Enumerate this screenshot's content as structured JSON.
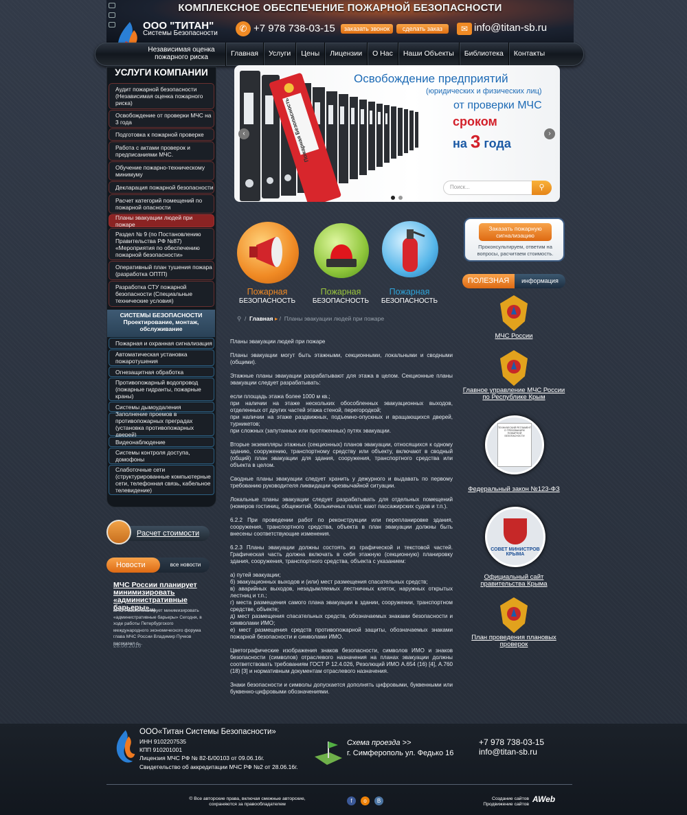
{
  "header": {
    "title": "КОМПЛЕКСНОЕ ОБЕСПЕЧЕНИЕ ПОЖАРНОЙ БЕЗОПАСНОСТИ",
    "brand": "ООО \"ТИТАН\"",
    "brand_sub": "Системы Безопасности",
    "phone": "+7 978 738-03-15",
    "callback_btn": "заказать звонок",
    "order_btn": "сделать заказ",
    "email": "info@titan-sb.ru"
  },
  "nav": {
    "tagline": "Независимая оценка пожарного риска",
    "items": [
      "Главная",
      "Услуги",
      "Цены",
      "Лицензии",
      "О Нас",
      "Наши Объекты",
      "Библиотека",
      "Контакты"
    ]
  },
  "sidebar": {
    "heading": "УСЛУГИ КОМПАНИИ",
    "services": [
      "Аудит пожарной безопасности (Независимая оценка пожарного риска)",
      "Освобождение от проверки МЧС на 3 года",
      "Подготовка к пожарной проверке",
      "Работа с актами проверок и предписаниями МЧС.",
      "Обучение пожарно-техническому минимуму",
      "Декларация пожарной безопасности",
      "Расчет категорий помещений по пожарной опасности",
      "Планы эвакуации людей при пожаре",
      "Раздел № 9 (по Постановлению Правительства РФ №87) «Мероприятия по обеспечению пожарной безопасности»",
      "Оперативный план тушения пожара (разработка ОПТП)",
      "Разработка СТУ пожарной безопасности (Специальные технические условия)"
    ],
    "systems_heading_1": "СИСТЕМЫ БЕЗОПАСНОСТИ",
    "systems_heading_2": "Проектирование, монтаж, обслуживание",
    "systems": [
      "Пожарная и охранная сигнализация",
      "Автоматическая установка пожаротушения",
      "Огнезащитная обработка",
      "Противопожарный водопровод (пожарные гидранты, пожарные краны)",
      "Системы дымоудаления",
      "Заполнение проемов в противопожарных преградах (установка противопожарных дверей)",
      "Видеонаблюдение",
      "Системы контроля доступа, домофоны",
      "Слаботочные сети (структурированные компьютерные сети, телефонная связь, кабельное телевидение)"
    ],
    "calc_label": "Расчет стоимости",
    "news_label": "Новости",
    "all_news": "все новости",
    "news_title": "МЧС России планирует минимизировать «административные барьеры»...",
    "news_text": "МЧС России планирует минимизировать «административные барьеры» Сегодня, в ходе работы Петербургского международного экономического форума глава МЧС России Владимир Пучков рассказал о...",
    "news_date": "28.06.2016"
  },
  "slider": {
    "line1": "Освобождение предприятий",
    "line2": "(юридических и физических лиц)",
    "line3": "от проверки МЧС",
    "line4": "сроком",
    "line5a": "на",
    "line5b": "3",
    "line5c": "года",
    "binder_text": "Пожарная Безопасность",
    "search_placeholder": "Поиск..."
  },
  "features": [
    {
      "t1": "Пожарная",
      "t2": "БЕЗОПАСНОСТЬ",
      "color": "#f08a24"
    },
    {
      "t1": "Пожарная",
      "t2": "БЕЗОПАСНОСТЬ",
      "color": "#9bc53d"
    },
    {
      "t1": "Пожарная",
      "t2": "БЕЗОПАСНОСТЬ",
      "color": "#2fa4d9"
    }
  ],
  "breadcrumb": {
    "home": "Главная",
    "current": "Планы эвакуации людей при пожаре"
  },
  "content": {
    "paragraphs": [
      "Планы эвакуации людей при пожаре",
      "Планы эвакуации могут быть этажными, секционными, локальными и сводными (общими).",
      "Этажные планы эвакуации разрабатывают для этажа в целом. Секционные планы эвакуации следует разрабатывать:",
      "если площадь этажа более 1000 м кв.;\nпри наличии на этаже нескольких обособленных эвакуационных выходов, отделенных от других частей этажа стеной, перегородкой;\nпри наличии на этаже раздвижных, подъемно-опускных и вращающихся дверей, турникетов;\nпри сложных (запутанных или протяженных) путях эвакуации.",
      "",
      "Вторые экземпляры этажных (секционных) планов эвакуации, относящихся к одному зданию, сооружению, транспортному средству или объекту, включают в сводный (общий) план эвакуации для здания, сооружения, транспортного средства или объекта в целом.",
      "Сводные планы эвакуации следует хранить у дежурного и выдавать по первому требованию руководителя ликвидации чрезвычайной ситуации.",
      "Локальные планы эвакуации следует разрабатывать для отдельных помещений (номеров гостиниц, общежитий, больничных палат, кают пассажирских судов и т.п.).",
      "6.2.2 При проведении работ по реконструкции или перепланировке здания, сооружения, транспортного средства, объекта в план эвакуации должны быть внесены соответствующие изменения.",
      "6.2.3 Планы эвакуации должны состоять из графической и текстовой частей. Графическая часть должна включать в себя этажную (секционную) планировку здания, сооружения, транспортного средства, объекта с указанием:",
      "а) путей эвакуации;\nб) эвакуационных выходов и (или) мест размещения спасательных средств;\nв) аварийных выходов, незадымляемых лестничных клеток, наружных открытых лестниц и т.п.;\nг) места размещения самого плана эвакуации в здании, сооружении, транспортном средстве, объекте;\nд) мест размещения спасательных средств, обозначаемых знаками безопасности и символами ИМО;\nе) мест размещения средств противопожарной защиты, обозначаемых знаками пожарной безопасности и символами ИМО.",
      "",
      "Цветографические изображения знаков безопасности, символов ИМО и знаков безопасности (символов) отраслевого назначения на планах эвакуации должны соответствовать требованиям ГОСТ Р 12.4.026, Резолюций ИМО А.654 (16) [4], А.760 (18) [3] и нормативным документам отраслевого назначения.",
      "Знаки безопасности и символы допускается дополнять цифровыми, буквенными или буквенно-цифровыми обозначениями."
    ]
  },
  "right": {
    "order_btn": "Заказать пожарную сигнализацию",
    "order_text": "Проконсультируем, ответим на вопросы, расчитаем стоимость.",
    "info_l": "ПОЛЕЗНАЯ",
    "info_r": "информация",
    "links": [
      "МЧС России",
      "Главное управление МЧС России по Республике Крым",
      "Федеральный закон №123-ФЗ",
      "Официальный сайт правительства Крыма",
      "План проведения плановых проверок"
    ],
    "reg_doc_text": "ТЕХНИЧЕСКИЙ РЕГЛАМЕНТ О ТРЕБОВАНИЯХ ПОЖАРНОЙ БЕЗОПАСНОСТИ",
    "crimea_text": "СОВЕТ МИНИСТРОВ КРЫМА"
  },
  "footer": {
    "name": "ООО«Титан Системы Безопасности»",
    "inn": "ИНН 9102207535",
    "kpp": "КПП 910201001",
    "license": "Лицензия МЧС РФ № 82-Б/00103 от 09.06.16г.",
    "accred": "Свидетельство об аккредитации МЧС РФ №2 от 28.06.16г.",
    "schema": "Схема проезда >>",
    "address": "г. Симферополь ул. Федько 16",
    "phone": "+7 978 738-03-15",
    "email": "info@titan-sb.ru",
    "copyright": "© Все авторские права, включая смежные авторские, сохраняются за правообладателем",
    "dev": "Создание сайтов Продвижение сайтов",
    "dev_logo": "AWeb",
    "social": [
      "f",
      "о",
      "В"
    ]
  }
}
